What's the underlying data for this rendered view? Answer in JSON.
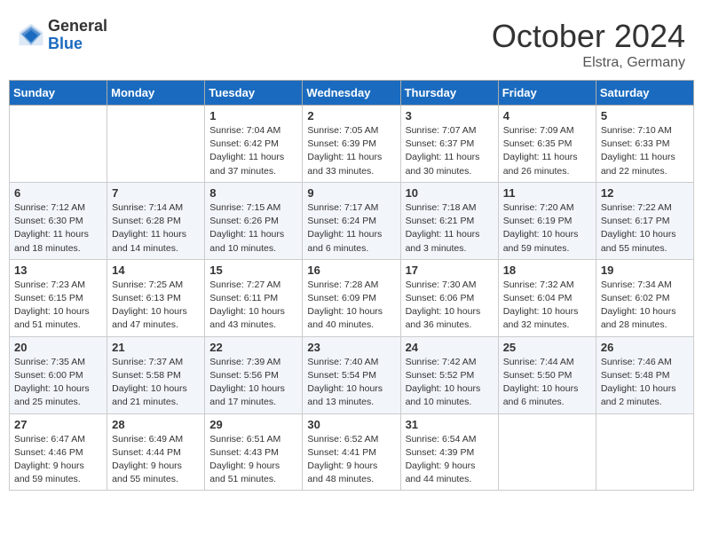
{
  "header": {
    "logo_general": "General",
    "logo_blue": "Blue",
    "month_title": "October 2024",
    "location": "Elstra, Germany"
  },
  "days_of_week": [
    "Sunday",
    "Monday",
    "Tuesday",
    "Wednesday",
    "Thursday",
    "Friday",
    "Saturday"
  ],
  "weeks": [
    [
      {
        "day": "",
        "info": ""
      },
      {
        "day": "",
        "info": ""
      },
      {
        "day": "1",
        "info": "Sunrise: 7:04 AM\nSunset: 6:42 PM\nDaylight: 11 hours and 37 minutes."
      },
      {
        "day": "2",
        "info": "Sunrise: 7:05 AM\nSunset: 6:39 PM\nDaylight: 11 hours and 33 minutes."
      },
      {
        "day": "3",
        "info": "Sunrise: 7:07 AM\nSunset: 6:37 PM\nDaylight: 11 hours and 30 minutes."
      },
      {
        "day": "4",
        "info": "Sunrise: 7:09 AM\nSunset: 6:35 PM\nDaylight: 11 hours and 26 minutes."
      },
      {
        "day": "5",
        "info": "Sunrise: 7:10 AM\nSunset: 6:33 PM\nDaylight: 11 hours and 22 minutes."
      }
    ],
    [
      {
        "day": "6",
        "info": "Sunrise: 7:12 AM\nSunset: 6:30 PM\nDaylight: 11 hours and 18 minutes."
      },
      {
        "day": "7",
        "info": "Sunrise: 7:14 AM\nSunset: 6:28 PM\nDaylight: 11 hours and 14 minutes."
      },
      {
        "day": "8",
        "info": "Sunrise: 7:15 AM\nSunset: 6:26 PM\nDaylight: 11 hours and 10 minutes."
      },
      {
        "day": "9",
        "info": "Sunrise: 7:17 AM\nSunset: 6:24 PM\nDaylight: 11 hours and 6 minutes."
      },
      {
        "day": "10",
        "info": "Sunrise: 7:18 AM\nSunset: 6:21 PM\nDaylight: 11 hours and 3 minutes."
      },
      {
        "day": "11",
        "info": "Sunrise: 7:20 AM\nSunset: 6:19 PM\nDaylight: 10 hours and 59 minutes."
      },
      {
        "day": "12",
        "info": "Sunrise: 7:22 AM\nSunset: 6:17 PM\nDaylight: 10 hours and 55 minutes."
      }
    ],
    [
      {
        "day": "13",
        "info": "Sunrise: 7:23 AM\nSunset: 6:15 PM\nDaylight: 10 hours and 51 minutes."
      },
      {
        "day": "14",
        "info": "Sunrise: 7:25 AM\nSunset: 6:13 PM\nDaylight: 10 hours and 47 minutes."
      },
      {
        "day": "15",
        "info": "Sunrise: 7:27 AM\nSunset: 6:11 PM\nDaylight: 10 hours and 43 minutes."
      },
      {
        "day": "16",
        "info": "Sunrise: 7:28 AM\nSunset: 6:09 PM\nDaylight: 10 hours and 40 minutes."
      },
      {
        "day": "17",
        "info": "Sunrise: 7:30 AM\nSunset: 6:06 PM\nDaylight: 10 hours and 36 minutes."
      },
      {
        "day": "18",
        "info": "Sunrise: 7:32 AM\nSunset: 6:04 PM\nDaylight: 10 hours and 32 minutes."
      },
      {
        "day": "19",
        "info": "Sunrise: 7:34 AM\nSunset: 6:02 PM\nDaylight: 10 hours and 28 minutes."
      }
    ],
    [
      {
        "day": "20",
        "info": "Sunrise: 7:35 AM\nSunset: 6:00 PM\nDaylight: 10 hours and 25 minutes."
      },
      {
        "day": "21",
        "info": "Sunrise: 7:37 AM\nSunset: 5:58 PM\nDaylight: 10 hours and 21 minutes."
      },
      {
        "day": "22",
        "info": "Sunrise: 7:39 AM\nSunset: 5:56 PM\nDaylight: 10 hours and 17 minutes."
      },
      {
        "day": "23",
        "info": "Sunrise: 7:40 AM\nSunset: 5:54 PM\nDaylight: 10 hours and 13 minutes."
      },
      {
        "day": "24",
        "info": "Sunrise: 7:42 AM\nSunset: 5:52 PM\nDaylight: 10 hours and 10 minutes."
      },
      {
        "day": "25",
        "info": "Sunrise: 7:44 AM\nSunset: 5:50 PM\nDaylight: 10 hours and 6 minutes."
      },
      {
        "day": "26",
        "info": "Sunrise: 7:46 AM\nSunset: 5:48 PM\nDaylight: 10 hours and 2 minutes."
      }
    ],
    [
      {
        "day": "27",
        "info": "Sunrise: 6:47 AM\nSunset: 4:46 PM\nDaylight: 9 hours and 59 minutes."
      },
      {
        "day": "28",
        "info": "Sunrise: 6:49 AM\nSunset: 4:44 PM\nDaylight: 9 hours and 55 minutes."
      },
      {
        "day": "29",
        "info": "Sunrise: 6:51 AM\nSunset: 4:43 PM\nDaylight: 9 hours and 51 minutes."
      },
      {
        "day": "30",
        "info": "Sunrise: 6:52 AM\nSunset: 4:41 PM\nDaylight: 9 hours and 48 minutes."
      },
      {
        "day": "31",
        "info": "Sunrise: 6:54 AM\nSunset: 4:39 PM\nDaylight: 9 hours and 44 minutes."
      },
      {
        "day": "",
        "info": ""
      },
      {
        "day": "",
        "info": ""
      }
    ]
  ]
}
